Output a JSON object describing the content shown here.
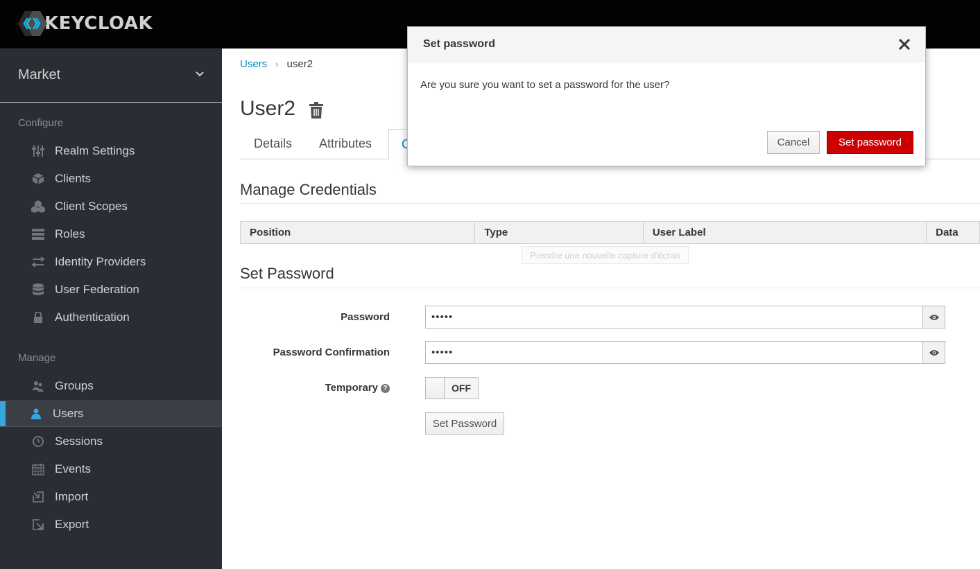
{
  "brand": {
    "logo_text": "KEYCLOAK"
  },
  "sidebar": {
    "realm": "Market",
    "configure_title": "Configure",
    "configure_items": [
      {
        "label": "Realm Settings",
        "icon": "sliders-icon"
      },
      {
        "label": "Clients",
        "icon": "cube-icon"
      },
      {
        "label": "Client Scopes",
        "icon": "cubes-icon"
      },
      {
        "label": "Roles",
        "icon": "list-icon"
      },
      {
        "label": "Identity Providers",
        "icon": "exchange-icon"
      },
      {
        "label": "User Federation",
        "icon": "database-icon"
      },
      {
        "label": "Authentication",
        "icon": "lock-icon"
      }
    ],
    "manage_title": "Manage",
    "manage_items": [
      {
        "label": "Groups",
        "icon": "users-icon"
      },
      {
        "label": "Users",
        "icon": "user-icon",
        "active": true
      },
      {
        "label": "Sessions",
        "icon": "clock-icon"
      },
      {
        "label": "Events",
        "icon": "calendar-icon"
      },
      {
        "label": "Import",
        "icon": "import-icon"
      },
      {
        "label": "Export",
        "icon": "export-icon"
      }
    ]
  },
  "breadcrumb": {
    "parent": "Users",
    "current": "user2"
  },
  "page": {
    "title": "User2"
  },
  "tabs": [
    {
      "label": "Details"
    },
    {
      "label": "Attributes"
    },
    {
      "label": "C",
      "active": true
    }
  ],
  "credentials": {
    "heading": "Manage Credentials",
    "columns": [
      "Position",
      "Type",
      "User Label",
      "Data"
    ],
    "tooltip": "Prendre une nouvelle capture d'écran"
  },
  "set_password": {
    "heading": "Set Password",
    "password_label": "Password",
    "password_value": "•••••",
    "confirm_label": "Password Confirmation",
    "confirm_value": "•••••",
    "temporary_label": "Temporary",
    "temporary_state": "OFF",
    "button": "Set Password"
  },
  "modal": {
    "title": "Set password",
    "message": "Are you sure you want to set a password for the user?",
    "cancel": "Cancel",
    "confirm": "Set password"
  },
  "colors": {
    "accent": "#0088ce",
    "danger": "#cc0000",
    "sidebar_bg": "#292e34",
    "active_bar": "#39a5dc"
  }
}
